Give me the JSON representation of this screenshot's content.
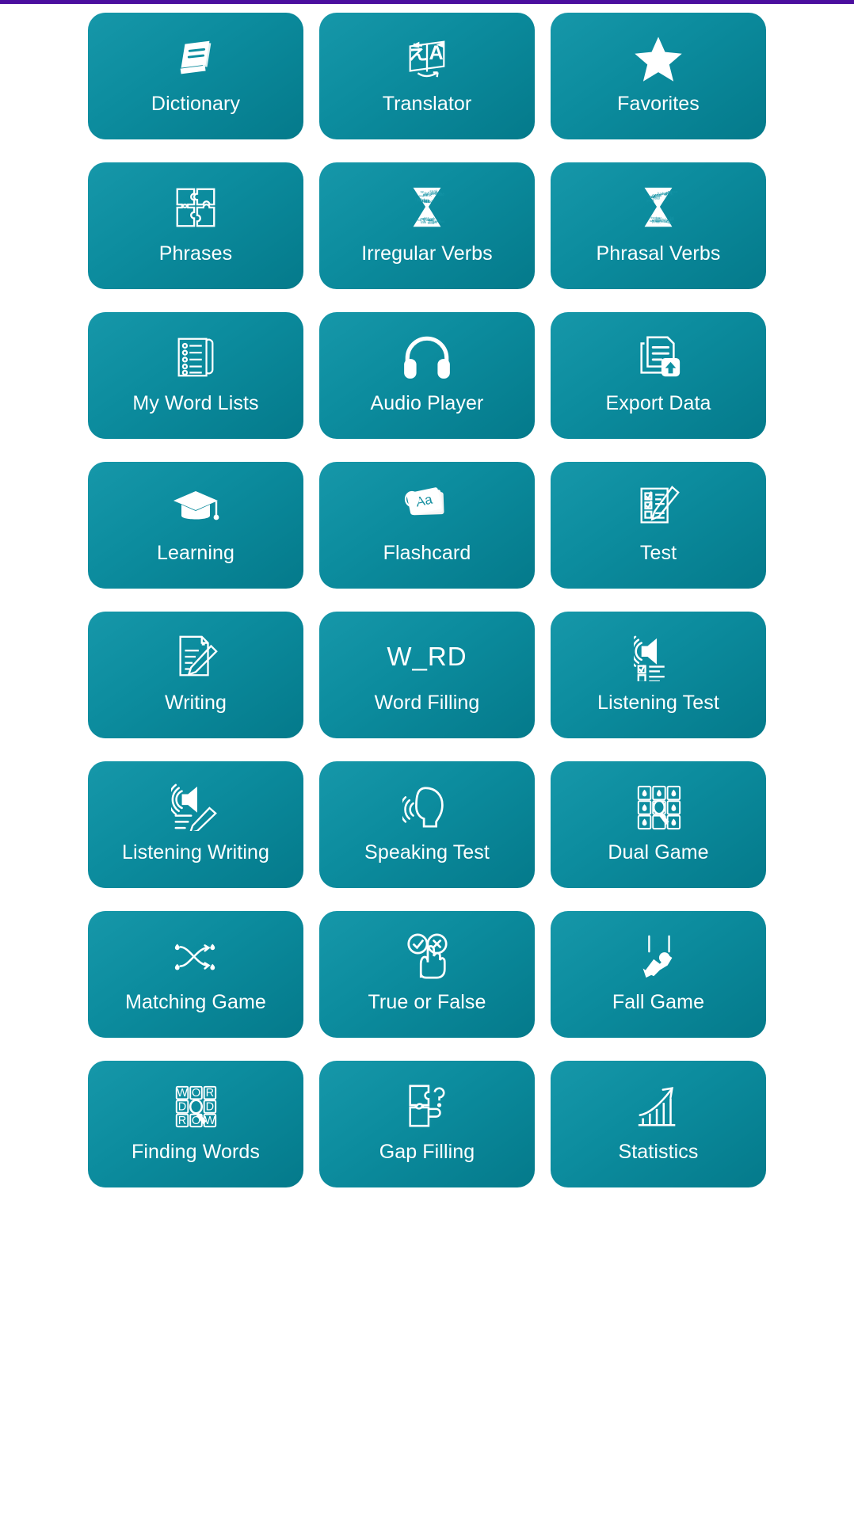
{
  "window": {
    "accent_bar_color": "#4b0f9e",
    "background_color": "#ffffff",
    "card_color_light": "#1697a9",
    "card_color_dark": "#047a8b",
    "label_color": "#ffffff"
  },
  "grid": {
    "columns": 3,
    "rows": 8,
    "items": [
      {
        "label": "Dictionary",
        "icon": "book-icon"
      },
      {
        "label": "Translator",
        "icon": "translate-card-icon",
        "glyphs": {
          "source": "え",
          "target": "A"
        }
      },
      {
        "label": "Favorites",
        "icon": "star-icon"
      },
      {
        "label": "Phrases",
        "icon": "puzzle-four-pieces-icon"
      },
      {
        "label": "Irregular Verbs",
        "icon": "hourglass-words-icon"
      },
      {
        "label": "Phrasal Verbs",
        "icon": "hourglass-words-icon"
      },
      {
        "label": "My Word Lists",
        "icon": "scroll-list-icon"
      },
      {
        "label": "Audio Player",
        "icon": "headphones-icon"
      },
      {
        "label": "Export Data",
        "icon": "documents-upload-icon"
      },
      {
        "label": "Learning",
        "icon": "graduation-cap-icon"
      },
      {
        "label": "Flashcard",
        "icon": "flashcards-icon",
        "glyphs": {
          "card_text": "Aa"
        }
      },
      {
        "label": "Test",
        "icon": "checklist-pencil-icon"
      },
      {
        "label": "Writing",
        "icon": "document-pencil-icon"
      },
      {
        "label": "Word Filling",
        "icon": "text-glyph",
        "glyphs": {
          "text": "W_RD"
        }
      },
      {
        "label": "Listening Test",
        "icon": "speaker-checklist-icon"
      },
      {
        "label": "Listening Writing",
        "icon": "speaker-pencil-icon"
      },
      {
        "label": "Speaking Test",
        "icon": "speaking-head-icon"
      },
      {
        "label": "Dual Game",
        "icon": "memory-card-grid-icon"
      },
      {
        "label": "Matching Game",
        "icon": "crossing-arrows-icon"
      },
      {
        "label": "True or False",
        "icon": "check-cross-hand-icon"
      },
      {
        "label": "Fall Game",
        "icon": "falling-figure-icon"
      },
      {
        "label": "Finding Words",
        "icon": "word-search-grid-icon",
        "glyphs": {
          "letters": [
            "W",
            "O",
            "R",
            "D",
            "O",
            "D",
            "R",
            "O",
            "W"
          ]
        }
      },
      {
        "label": "Gap Filling",
        "icon": "puzzle-question-icon"
      },
      {
        "label": "Statistics",
        "icon": "bar-chart-arrow-icon"
      }
    ]
  }
}
